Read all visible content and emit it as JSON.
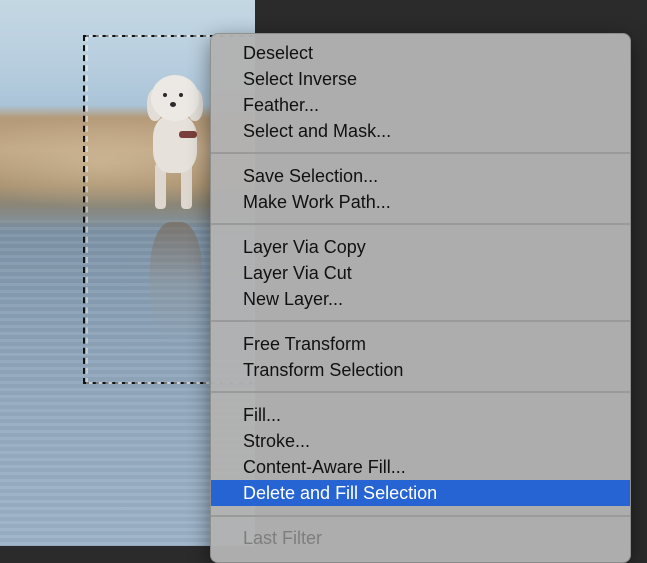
{
  "menu": {
    "groups": [
      [
        "Deselect",
        "Select Inverse",
        "Feather...",
        "Select and Mask..."
      ],
      [
        "Save Selection...",
        "Make Work Path..."
      ],
      [
        "Layer Via Copy",
        "Layer Via Cut",
        "New Layer..."
      ],
      [
        "Free Transform",
        "Transform Selection"
      ],
      [
        "Fill...",
        "Stroke...",
        "Content-Aware Fill...",
        "Delete and Fill Selection"
      ],
      [
        "Last Filter"
      ]
    ],
    "highlighted": "Delete and Fill Selection",
    "disabled": [
      "Last Filter"
    ],
    "highlight_color": "#2764d3"
  }
}
